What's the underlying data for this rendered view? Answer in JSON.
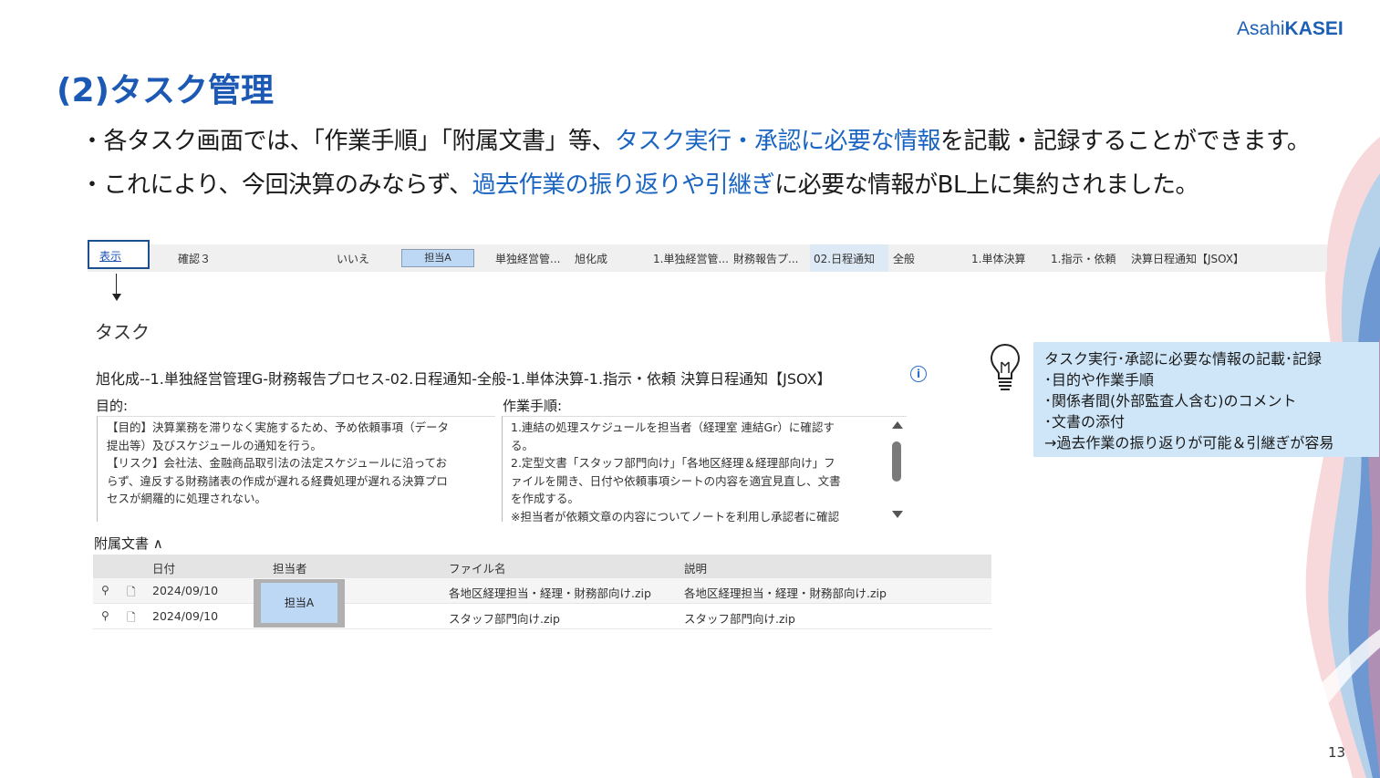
{
  "brand": {
    "logo_light": "Asahi",
    "logo_bold": "KASEI",
    "color": "#1c5fb4"
  },
  "slide": {
    "title": "(2)タスク管理",
    "page_number": "13",
    "bullets": [
      {
        "pre": "・各タスク画面では、「作業手順」「附属文書」等、",
        "highlight": "タスク実行・承認に必要な情報",
        "post": "を記載・記録することができます。"
      },
      {
        "pre": "・これにより、今回決算のみならず、",
        "highlight": "過去作業の振り返りや引継ぎ",
        "post": "に必要な情報がBL上に集約されました。"
      }
    ]
  },
  "list_row": {
    "show_link": "表示",
    "confirm": "確認３",
    "no": "いいえ",
    "assignee": "担当A",
    "col1": "単独経営管...",
    "company": "旭化成",
    "col3": "1.単独経営管...",
    "col4": "財務報告プ...",
    "col5": "02.日程通知",
    "col6": "全般",
    "col7": "1.単体決算",
    "col8": "1.指示・依頼",
    "col9": "決算日程通知【JSOX】"
  },
  "task": {
    "heading": "タスク",
    "full_name": "旭化成--1.単独経営管理G-財務報告プロセス-02.日程通知-全般-1.単体決算-1.指示・依頼 決算日程通知【JSOX】",
    "purpose_label": "目的:",
    "purpose_lines": [
      "【目的】決算業務を滞りなく実施するため、予め依頼事項（データ",
      "提出等）及びスケジュールの通知を行う。",
      "【リスク】会社法、金融商品取引法の法定スケジュールに沿ってお",
      "らず、違反する財務諸表の作成が遅れる経費処理が遅れる決算プロ",
      "セスが網羅的に処理されない。"
    ],
    "steps_label": "作業手順:",
    "steps_lines": [
      "1.連結の処理スケジュールを担当者（経理室 連結Gr）に確認す",
      "る。",
      "2.定型文書「スタッフ部門向け」「各地区経理＆経理部向け」フ",
      "ァイルを開き、日付や依頼事項シートの内容を適宜見直し、文書",
      "を作成する。",
      "※担当者が依頼文章の内容についてノートを利用し承認者に確認"
    ]
  },
  "attachments": {
    "heading": "附属文書",
    "columns": {
      "date": "日付",
      "assignee": "担当者",
      "filename": "ファイル名",
      "description": "説明"
    },
    "assignee": "担当A",
    "rows": [
      {
        "date": "2024/09/10",
        "filename": "各地区経理担当・経理・財務部向け.zip",
        "description": "各地区経理担当・経理・財務部向け.zip"
      },
      {
        "date": "2024/09/10",
        "filename": "スタッフ部門向け.zip",
        "description": "スタッフ部門向け.zip"
      }
    ]
  },
  "note": {
    "icon": "lightbulb-icon",
    "lines": [
      "タスク実行･承認に必要な情報の記載･記録",
      "･目的や作業手順",
      "･関係者間(外部監査人含む)のコメント",
      "･文書の添付",
      "→過去作業の振り返りが可能＆引継ぎが容易"
    ]
  }
}
